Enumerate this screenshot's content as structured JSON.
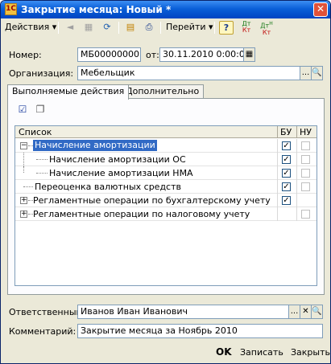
{
  "window": {
    "title": "Закрытие месяца: Новый *",
    "close_glyph": "✕"
  },
  "toolbar": {
    "actions_label": "Действия",
    "goto_label": "Перейти",
    "help_glyph": "?",
    "dt_label": "Дт",
    "kt_label": "Кт",
    "dt_h_label": "Дт",
    "kt_h_label": "Кт",
    "h_sup": "Н"
  },
  "form": {
    "number_label": "Номер:",
    "number_value": "МБ000000001",
    "date_label": "от:",
    "date_value": "30.11.2010  0:00:00",
    "org_label": "Организация:",
    "org_value": "Мебельщик",
    "responsible_label": "Ответственный:",
    "responsible_value": "Иванов Иван Иванович",
    "comment_label": "Комментарий:",
    "comment_value": "Закрытие месяца за Ноябрь 2010"
  },
  "tabs": [
    {
      "label": "Выполняемые действия"
    },
    {
      "label": "Дополнительно"
    }
  ],
  "grid": {
    "headers": {
      "list": "Список",
      "bu": "БУ",
      "nu": "НУ"
    },
    "rows": [
      {
        "label": "Начисление амортизации",
        "bu": true,
        "nu": false,
        "expander": "−",
        "selected": true
      },
      {
        "label": "Начисление амортизации ОС",
        "bu": true,
        "nu": false
      },
      {
        "label": "Начисление амортизации НМА",
        "bu": true,
        "nu": false
      },
      {
        "label": "Переоценка валютных средств",
        "bu": true,
        "nu": false
      },
      {
        "label": "Регламентные операции по бухгалтерскому учету",
        "bu": true,
        "expander": "+"
      },
      {
        "label": "Регламентные операции по налоговому учету",
        "nu": false,
        "expander": "+"
      }
    ]
  },
  "buttons": {
    "ok": "OK",
    "save": "Записать",
    "close": "Закрыть"
  },
  "glyphs": {
    "dropdown": "▾",
    "ellipsis": "...",
    "clear": "✕",
    "check": "✓"
  }
}
